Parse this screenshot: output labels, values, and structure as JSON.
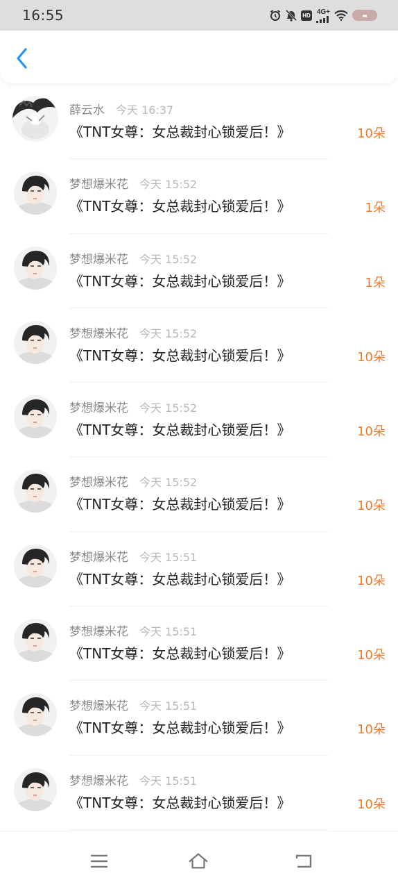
{
  "status_bar": {
    "time": "16:55",
    "network": "4G+",
    "hd": "HD",
    "icons": [
      "alarm-icon",
      "mute-icon",
      "hd-icon",
      "signal-icon",
      "wifi-icon",
      "battery-icon"
    ]
  },
  "header": {
    "back_icon": "chevron-left-icon",
    "accent_color": "#2196f3"
  },
  "list": {
    "items": [
      {
        "name": "薛云水",
        "time": "今天 16:37",
        "title": "《TNT女尊：女总裁封心锁爱后！》",
        "amount": "10朵",
        "avatar": "ink-avatar"
      },
      {
        "name": "梦想爆米花",
        "time": "今天 15:52",
        "title": "《TNT女尊：女总裁封心锁爱后！》",
        "amount": "1朵",
        "avatar": "boy-avatar"
      },
      {
        "name": "梦想爆米花",
        "time": "今天 15:52",
        "title": "《TNT女尊：女总裁封心锁爱后！》",
        "amount": "1朵",
        "avatar": "boy-avatar"
      },
      {
        "name": "梦想爆米花",
        "time": "今天 15:52",
        "title": "《TNT女尊：女总裁封心锁爱后！》",
        "amount": "10朵",
        "avatar": "boy-avatar"
      },
      {
        "name": "梦想爆米花",
        "time": "今天 15:52",
        "title": "《TNT女尊：女总裁封心锁爱后！》",
        "amount": "10朵",
        "avatar": "boy-avatar"
      },
      {
        "name": "梦想爆米花",
        "time": "今天 15:52",
        "title": "《TNT女尊：女总裁封心锁爱后！》",
        "amount": "10朵",
        "avatar": "boy-avatar"
      },
      {
        "name": "梦想爆米花",
        "time": "今天 15:51",
        "title": "《TNT女尊：女总裁封心锁爱后！》",
        "amount": "10朵",
        "avatar": "boy-avatar"
      },
      {
        "name": "梦想爆米花",
        "time": "今天 15:51",
        "title": "《TNT女尊：女总裁封心锁爱后！》",
        "amount": "10朵",
        "avatar": "boy-avatar"
      },
      {
        "name": "梦想爆米花",
        "time": "今天 15:51",
        "title": "《TNT女尊：女总裁封心锁爱后！》",
        "amount": "10朵",
        "avatar": "boy-avatar"
      },
      {
        "name": "梦想爆米花",
        "time": "今天 15:51",
        "title": "《TNT女尊：女总裁封心锁爱后！》",
        "amount": "10朵",
        "avatar": "boy-avatar"
      }
    ],
    "amount_color": "#f07a2c"
  },
  "nav_bar": {
    "icons": [
      "menu-icon",
      "home-icon",
      "back-icon"
    ]
  }
}
